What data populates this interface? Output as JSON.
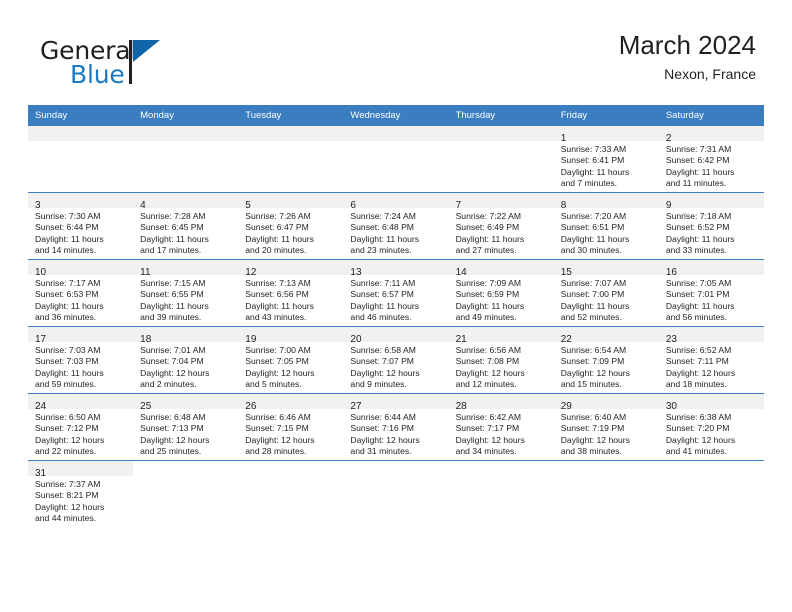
{
  "logo": {
    "text_top": "General",
    "text_bottom": "Blue",
    "brand_blue": "#1b7ac4",
    "triangle_blue": "#1064a8"
  },
  "header": {
    "title": "March 2024",
    "subtitle": "Nexon, France"
  },
  "theme": {
    "header_blue": "#3a7dc0",
    "daynum_band": "#f1f1f1",
    "text": "#231f20"
  },
  "weekdays": [
    "Sunday",
    "Monday",
    "Tuesday",
    "Wednesday",
    "Thursday",
    "Friday",
    "Saturday"
  ],
  "weeks": [
    [
      {
        "blank": true
      },
      {
        "blank": true
      },
      {
        "blank": true
      },
      {
        "blank": true
      },
      {
        "blank": true
      },
      {
        "day": "1",
        "sunrise": "Sunrise: 7:33 AM",
        "sunset": "Sunset: 6:41 PM",
        "daylight_1": "Daylight: 11 hours",
        "daylight_2": "and 7 minutes."
      },
      {
        "day": "2",
        "sunrise": "Sunrise: 7:31 AM",
        "sunset": "Sunset: 6:42 PM",
        "daylight_1": "Daylight: 11 hours",
        "daylight_2": "and 11 minutes."
      }
    ],
    [
      {
        "day": "3",
        "sunrise": "Sunrise: 7:30 AM",
        "sunset": "Sunset: 6:44 PM",
        "daylight_1": "Daylight: 11 hours",
        "daylight_2": "and 14 minutes."
      },
      {
        "day": "4",
        "sunrise": "Sunrise: 7:28 AM",
        "sunset": "Sunset: 6:45 PM",
        "daylight_1": "Daylight: 11 hours",
        "daylight_2": "and 17 minutes."
      },
      {
        "day": "5",
        "sunrise": "Sunrise: 7:26 AM",
        "sunset": "Sunset: 6:47 PM",
        "daylight_1": "Daylight: 11 hours",
        "daylight_2": "and 20 minutes."
      },
      {
        "day": "6",
        "sunrise": "Sunrise: 7:24 AM",
        "sunset": "Sunset: 6:48 PM",
        "daylight_1": "Daylight: 11 hours",
        "daylight_2": "and 23 minutes."
      },
      {
        "day": "7",
        "sunrise": "Sunrise: 7:22 AM",
        "sunset": "Sunset: 6:49 PM",
        "daylight_1": "Daylight: 11 hours",
        "daylight_2": "and 27 minutes."
      },
      {
        "day": "8",
        "sunrise": "Sunrise: 7:20 AM",
        "sunset": "Sunset: 6:51 PM",
        "daylight_1": "Daylight: 11 hours",
        "daylight_2": "and 30 minutes."
      },
      {
        "day": "9",
        "sunrise": "Sunrise: 7:18 AM",
        "sunset": "Sunset: 6:52 PM",
        "daylight_1": "Daylight: 11 hours",
        "daylight_2": "and 33 minutes."
      }
    ],
    [
      {
        "day": "10",
        "sunrise": "Sunrise: 7:17 AM",
        "sunset": "Sunset: 6:53 PM",
        "daylight_1": "Daylight: 11 hours",
        "daylight_2": "and 36 minutes."
      },
      {
        "day": "11",
        "sunrise": "Sunrise: 7:15 AM",
        "sunset": "Sunset: 6:55 PM",
        "daylight_1": "Daylight: 11 hours",
        "daylight_2": "and 39 minutes."
      },
      {
        "day": "12",
        "sunrise": "Sunrise: 7:13 AM",
        "sunset": "Sunset: 6:56 PM",
        "daylight_1": "Daylight: 11 hours",
        "daylight_2": "and 43 minutes."
      },
      {
        "day": "13",
        "sunrise": "Sunrise: 7:11 AM",
        "sunset": "Sunset: 6:57 PM",
        "daylight_1": "Daylight: 11 hours",
        "daylight_2": "and 46 minutes."
      },
      {
        "day": "14",
        "sunrise": "Sunrise: 7:09 AM",
        "sunset": "Sunset: 6:59 PM",
        "daylight_1": "Daylight: 11 hours",
        "daylight_2": "and 49 minutes."
      },
      {
        "day": "15",
        "sunrise": "Sunrise: 7:07 AM",
        "sunset": "Sunset: 7:00 PM",
        "daylight_1": "Daylight: 11 hours",
        "daylight_2": "and 52 minutes."
      },
      {
        "day": "16",
        "sunrise": "Sunrise: 7:05 AM",
        "sunset": "Sunset: 7:01 PM",
        "daylight_1": "Daylight: 11 hours",
        "daylight_2": "and 56 minutes."
      }
    ],
    [
      {
        "day": "17",
        "sunrise": "Sunrise: 7:03 AM",
        "sunset": "Sunset: 7:03 PM",
        "daylight_1": "Daylight: 11 hours",
        "daylight_2": "and 59 minutes."
      },
      {
        "day": "18",
        "sunrise": "Sunrise: 7:01 AM",
        "sunset": "Sunset: 7:04 PM",
        "daylight_1": "Daylight: 12 hours",
        "daylight_2": "and 2 minutes."
      },
      {
        "day": "19",
        "sunrise": "Sunrise: 7:00 AM",
        "sunset": "Sunset: 7:05 PM",
        "daylight_1": "Daylight: 12 hours",
        "daylight_2": "and 5 minutes."
      },
      {
        "day": "20",
        "sunrise": "Sunrise: 6:58 AM",
        "sunset": "Sunset: 7:07 PM",
        "daylight_1": "Daylight: 12 hours",
        "daylight_2": "and 9 minutes."
      },
      {
        "day": "21",
        "sunrise": "Sunrise: 6:56 AM",
        "sunset": "Sunset: 7:08 PM",
        "daylight_1": "Daylight: 12 hours",
        "daylight_2": "and 12 minutes."
      },
      {
        "day": "22",
        "sunrise": "Sunrise: 6:54 AM",
        "sunset": "Sunset: 7:09 PM",
        "daylight_1": "Daylight: 12 hours",
        "daylight_2": "and 15 minutes."
      },
      {
        "day": "23",
        "sunrise": "Sunrise: 6:52 AM",
        "sunset": "Sunset: 7:11 PM",
        "daylight_1": "Daylight: 12 hours",
        "daylight_2": "and 18 minutes."
      }
    ],
    [
      {
        "day": "24",
        "sunrise": "Sunrise: 6:50 AM",
        "sunset": "Sunset: 7:12 PM",
        "daylight_1": "Daylight: 12 hours",
        "daylight_2": "and 22 minutes."
      },
      {
        "day": "25",
        "sunrise": "Sunrise: 6:48 AM",
        "sunset": "Sunset: 7:13 PM",
        "daylight_1": "Daylight: 12 hours",
        "daylight_2": "and 25 minutes."
      },
      {
        "day": "26",
        "sunrise": "Sunrise: 6:46 AM",
        "sunset": "Sunset: 7:15 PM",
        "daylight_1": "Daylight: 12 hours",
        "daylight_2": "and 28 minutes."
      },
      {
        "day": "27",
        "sunrise": "Sunrise: 6:44 AM",
        "sunset": "Sunset: 7:16 PM",
        "daylight_1": "Daylight: 12 hours",
        "daylight_2": "and 31 minutes."
      },
      {
        "day": "28",
        "sunrise": "Sunrise: 6:42 AM",
        "sunset": "Sunset: 7:17 PM",
        "daylight_1": "Daylight: 12 hours",
        "daylight_2": "and 34 minutes."
      },
      {
        "day": "29",
        "sunrise": "Sunrise: 6:40 AM",
        "sunset": "Sunset: 7:19 PM",
        "daylight_1": "Daylight: 12 hours",
        "daylight_2": "and 38 minutes."
      },
      {
        "day": "30",
        "sunrise": "Sunrise: 6:38 AM",
        "sunset": "Sunset: 7:20 PM",
        "daylight_1": "Daylight: 12 hours",
        "daylight_2": "and 41 minutes."
      }
    ],
    [
      {
        "day": "31",
        "sunrise": "Sunrise: 7:37 AM",
        "sunset": "Sunset: 8:21 PM",
        "daylight_1": "Daylight: 12 hours",
        "daylight_2": "and 44 minutes."
      },
      {
        "blank": true
      },
      {
        "blank": true
      },
      {
        "blank": true
      },
      {
        "blank": true
      },
      {
        "blank": true
      },
      {
        "blank": true
      }
    ]
  ]
}
